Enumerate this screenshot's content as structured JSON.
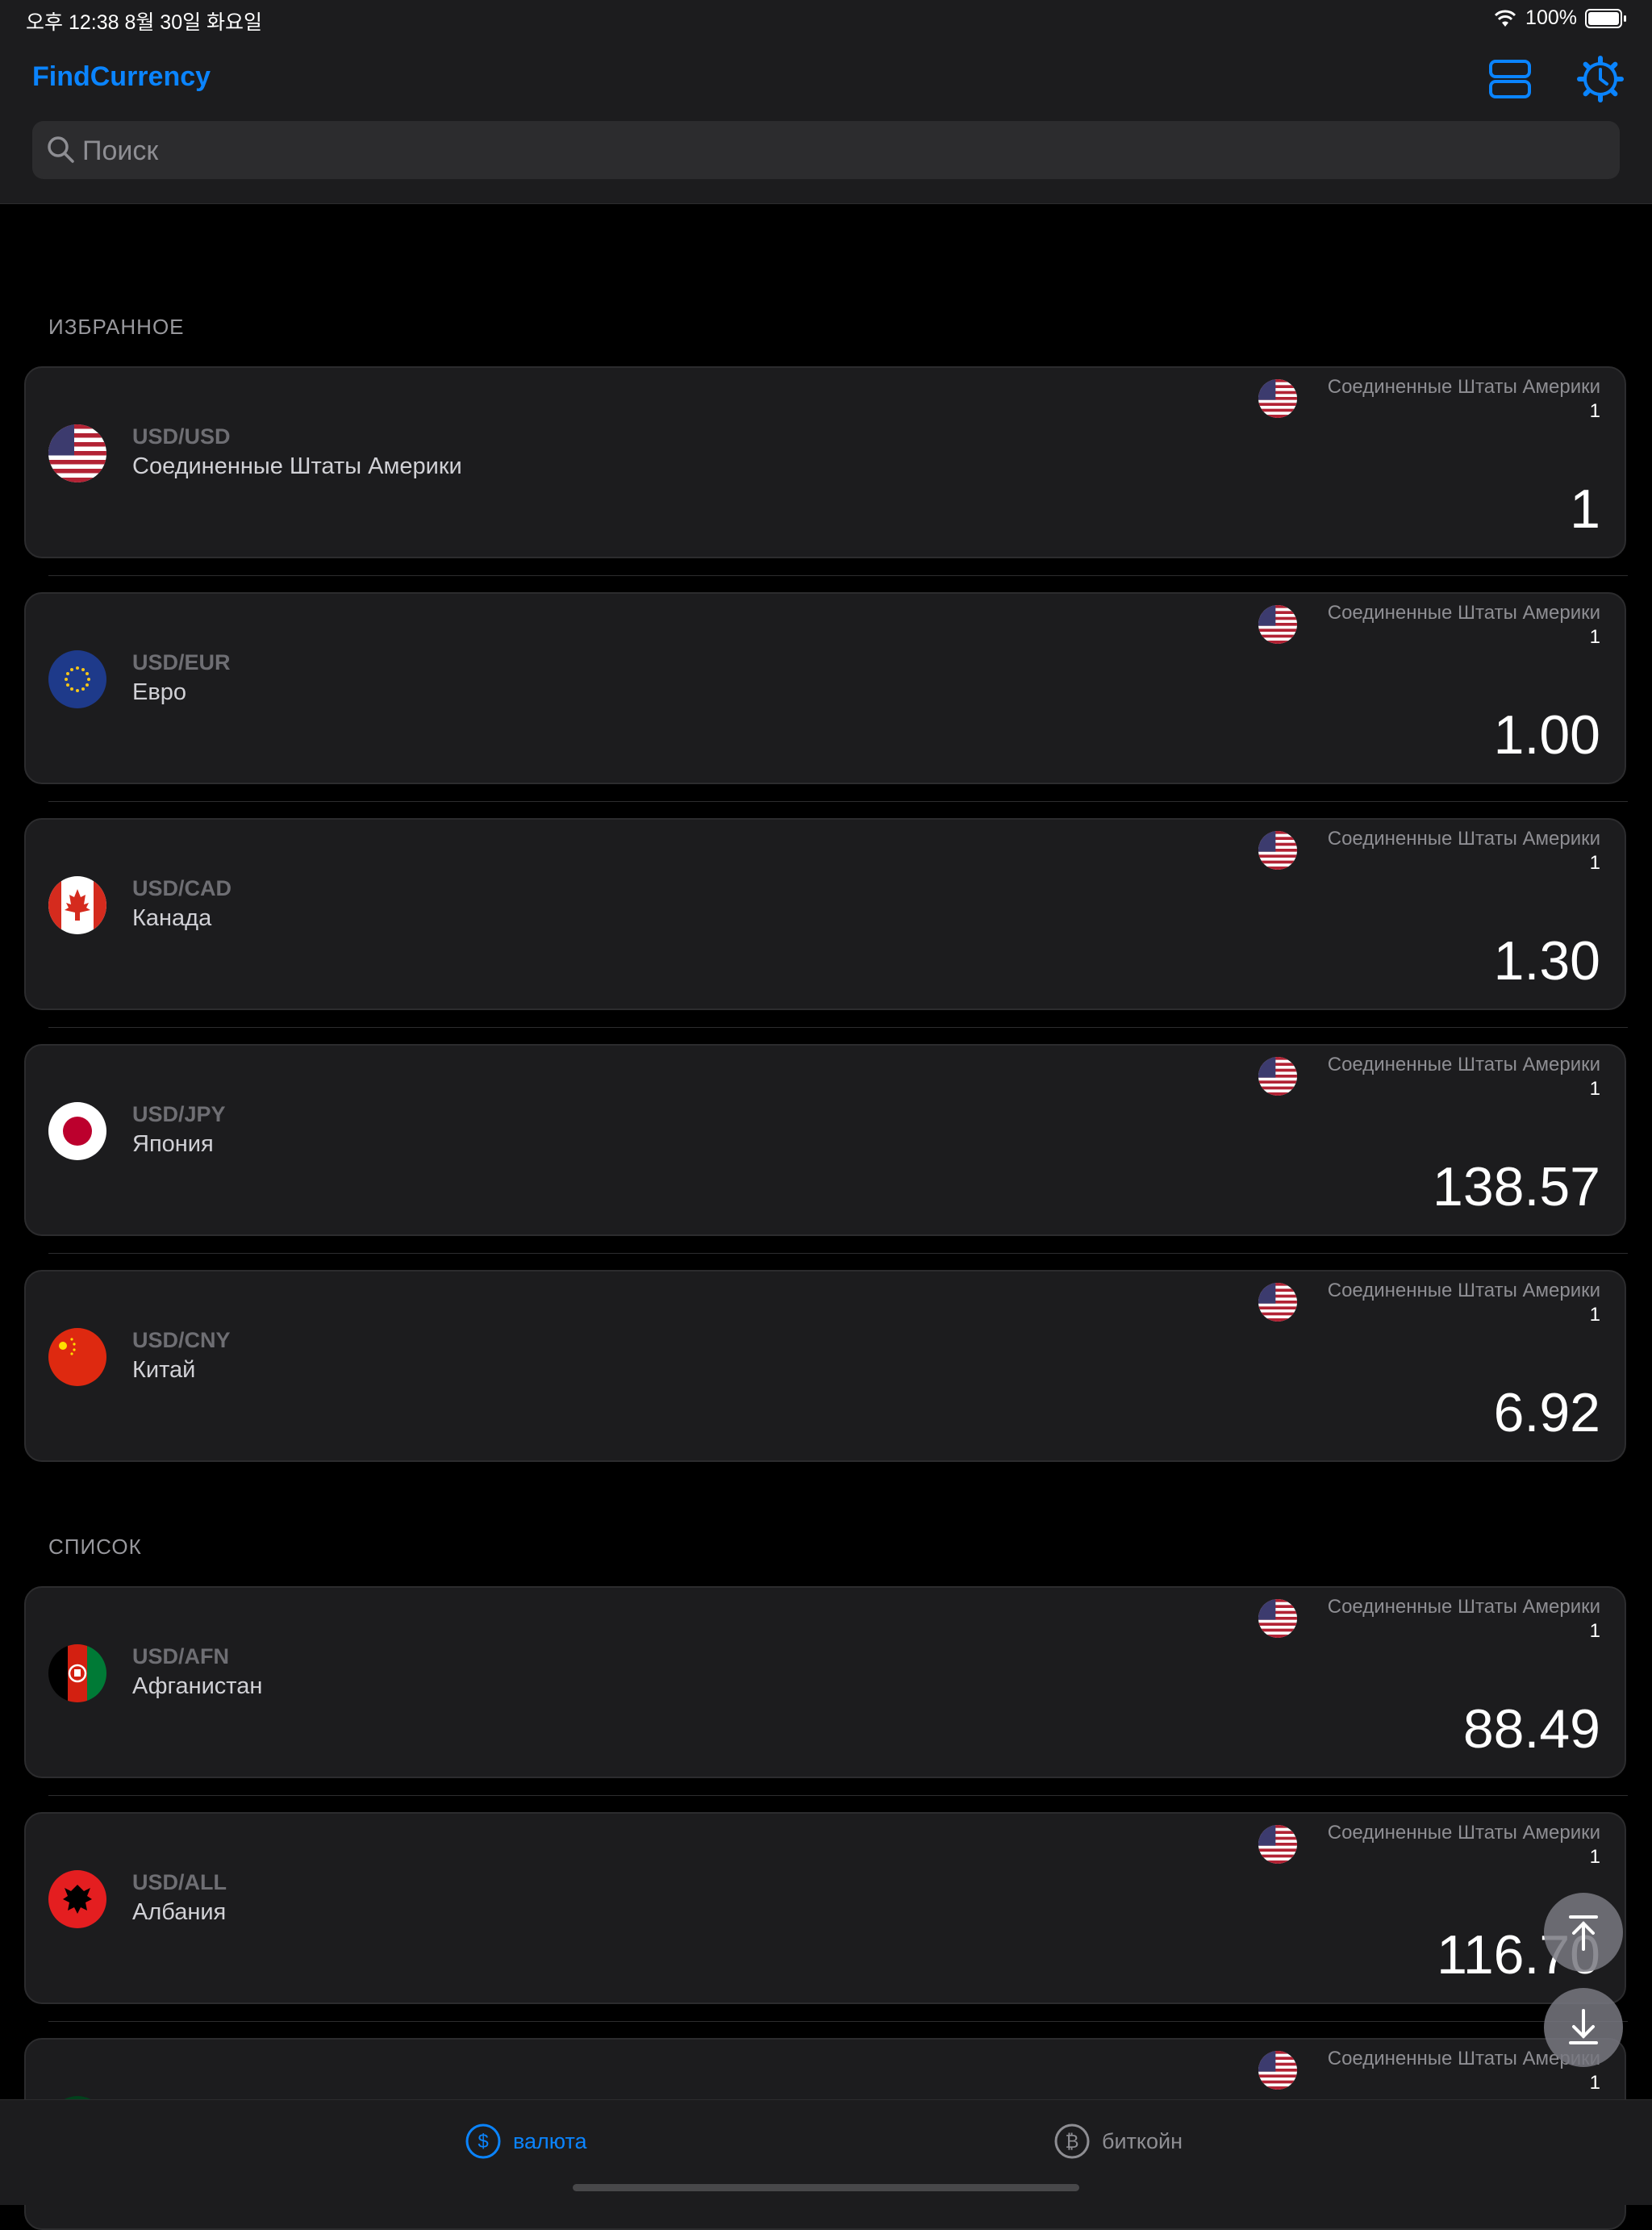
{
  "status_bar": {
    "time_date": "오후 12:38   8월 30일 화요일",
    "battery": "100%"
  },
  "header": {
    "title": "FindCurrency"
  },
  "search": {
    "placeholder": "Поиск"
  },
  "favorites": {
    "title": "ИЗБРАННОЕ",
    "items": [
      {
        "pair": "USD/USD",
        "name": "Соединенные Штаты Америки",
        "base_name": "Соединенные Штаты Америки",
        "base_amount": "1",
        "rate": "1",
        "flag": "us-flag-icon"
      },
      {
        "pair": "USD/EUR",
        "name": "Евро",
        "base_name": "Соединенные Штаты Америки",
        "base_amount": "1",
        "rate": "1.00",
        "flag": "eu-flag-icon"
      },
      {
        "pair": "USD/CAD",
        "name": "Канада",
        "base_name": "Соединенные Штаты Америки",
        "base_amount": "1",
        "rate": "1.30",
        "flag": "canada-flag-icon"
      },
      {
        "pair": "USD/JPY",
        "name": "Япония",
        "base_name": "Соединенные Штаты Америки",
        "base_amount": "1",
        "rate": "138.57",
        "flag": "japan-flag-icon"
      },
      {
        "pair": "USD/CNY",
        "name": "Китай",
        "base_name": "Соединенные Штаты Америки",
        "base_amount": "1",
        "rate": "6.92",
        "flag": "china-flag-icon"
      }
    ]
  },
  "list": {
    "title": "СПИСОК",
    "items": [
      {
        "pair": "USD/AFN",
        "name": "Афганистан",
        "base_name": "Соединенные Штаты Америки",
        "base_amount": "1",
        "rate": "88.49",
        "flag": "afghanistan-flag-icon"
      },
      {
        "pair": "USD/ALL",
        "name": "Албания",
        "base_name": "Соединенные Штаты Америки",
        "base_amount": "1",
        "rate": "116.70",
        "flag": "albania-flag-icon"
      },
      {
        "pair": "",
        "name": "",
        "base_name": "Соединенные Штаты Америки",
        "base_amount": "1",
        "rate": "",
        "flag": "partial-flag-icon"
      }
    ]
  },
  "tabs": [
    {
      "label": "валюта",
      "icon": "dollar-circle-icon",
      "selected": true
    },
    {
      "label": "биткойн",
      "icon": "bitcoin-circle-icon",
      "selected": false
    }
  ],
  "colors": {
    "accent": "#0a84ff",
    "background": "#000000",
    "card": "#1c1c1e",
    "inactive": "#8e8e93"
  }
}
